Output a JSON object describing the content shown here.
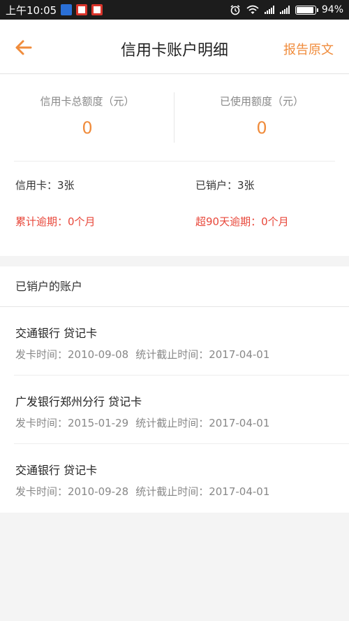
{
  "status_bar": {
    "time": "上午10:05",
    "battery": "94%",
    "battery_level": 0.94
  },
  "header": {
    "back_icon": "arrow-left-icon",
    "title": "信用卡账户明细",
    "action": "报告原文"
  },
  "summary": {
    "total_limit_label": "信用卡总额度（元）",
    "total_limit_value": "0",
    "used_limit_label": "已使用额度（元）",
    "used_limit_value": "0",
    "card_count": "信用卡：3张",
    "closed_count": "已销户：3张",
    "overdue_total": "累计逾期：0个月",
    "overdue_90": "超90天逾期：0个月"
  },
  "closed_accounts": {
    "title": "已销户的账户",
    "items": [
      {
        "name": "交通银行 贷记卡",
        "issue": "发卡时间：2010-09-08",
        "cutoff": "统计截止时间：2017-04-01"
      },
      {
        "name": "广发银行郑州分行 贷记卡",
        "issue": "发卡时间：2015-01-29",
        "cutoff": "统计截止时间：2017-04-01"
      },
      {
        "name": "交通银行 贷记卡",
        "issue": "发卡时间：2010-09-28",
        "cutoff": "统计截止时间：2017-04-01"
      }
    ]
  },
  "colors": {
    "accent": "#f08c3c",
    "warning": "#e8473a"
  }
}
